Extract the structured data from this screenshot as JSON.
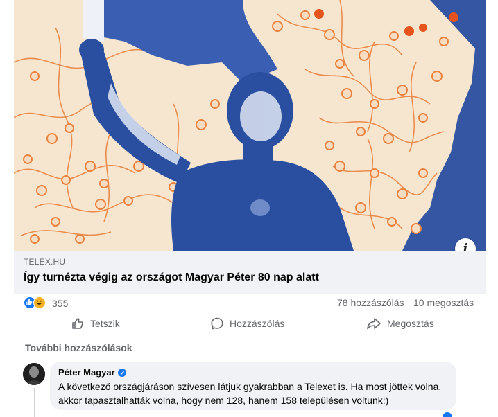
{
  "post": {
    "link": {
      "domain": "TELEX.HU",
      "title": "Így turnézta végig az országot Magyar Péter 80 nap alatt"
    },
    "image_info_label": "i",
    "reactions": {
      "icons": [
        "like-icon",
        "haha-icon"
      ],
      "count": "355"
    },
    "stats": {
      "comments": "78 hozzászólás",
      "shares": "10 megosztás"
    },
    "actions": {
      "like": "Tetszik",
      "comment": "Hozzászólás",
      "share": "Megosztás"
    }
  },
  "comments": {
    "more_label": "További hozzászólások",
    "items": [
      {
        "author": "Péter Magyar",
        "verified": true,
        "text": "A következő országjáráson szívesen látjuk gyakrabban a Telexet is. Ha most jöttek volna, akkor tapasztalhatták volna, hogy nem 128, hanem 158 településen voltunk:)"
      }
    ]
  },
  "colors": {
    "accent": "#1877f2",
    "map_lines": "#e9823e",
    "map_bg": "#f7e6cf",
    "photo_blue": "#2a4fa0",
    "muted_text": "#65676b",
    "preview_bg": "#f0f2f5"
  }
}
